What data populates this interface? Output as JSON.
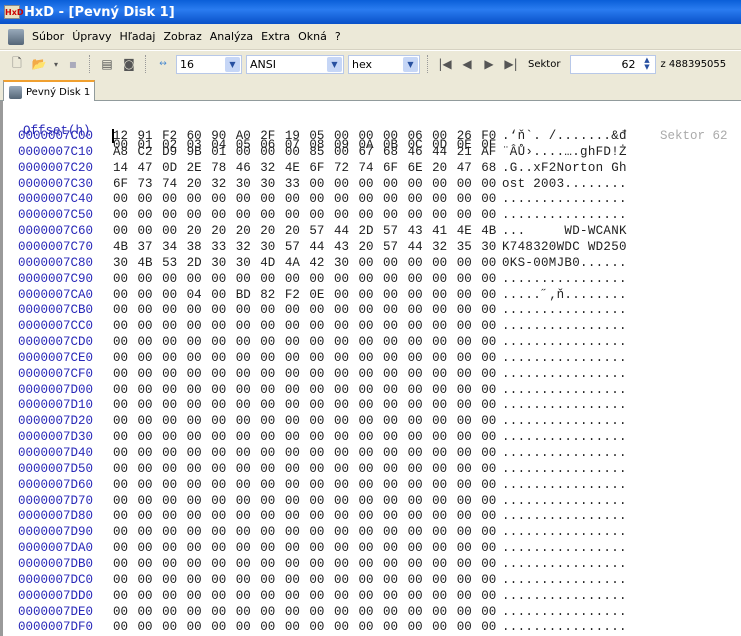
{
  "window": {
    "title": "HxD - [Pevný Disk 1]"
  },
  "menu": [
    "Súbor",
    "Úpravy",
    "Hľadaj",
    "Zobraz",
    "Analýza",
    "Extra",
    "Okná",
    "?"
  ],
  "toolbar": {
    "bytes_per_row": "16",
    "charset": "ANSI",
    "offset_base": "hex",
    "sector_label": "Sektor",
    "sector_value": "62",
    "sector_total": "z 488395055"
  },
  "tab": {
    "label": "Pevný Disk 1"
  },
  "editor": {
    "offset_header": "Offset(h)",
    "columns": [
      "00",
      "01",
      "02",
      "03",
      "04",
      "05",
      "06",
      "07",
      "08",
      "09",
      "0A",
      "0B",
      "0C",
      "0D",
      "0E",
      "0F"
    ],
    "sector_marker": "Sektor 62",
    "rows": [
      {
        "offset": "0000007C00",
        "hex": "12 91 F2 60 90 A0 2F 19 05 00 00 00 06 00 26 F0",
        "ascii": ".‘ň`. /.......&đ"
      },
      {
        "offset": "0000007C10",
        "hex": "A8 C2 D9 9B 01 00 00 00 85 00 67 68 46 44 21 AF",
        "ascii": "¨ÂŮ›....….ghFD!Ż"
      },
      {
        "offset": "0000007C20",
        "hex": "14 47 0D 2E 78 46 32 4E 6F 72 74 6F 6E 20 47 68",
        "ascii": ".G..xF2Norton Gh"
      },
      {
        "offset": "0000007C30",
        "hex": "6F 73 74 20 32 30 30 33 00 00 00 00 00 00 00 00",
        "ascii": "ost 2003........"
      },
      {
        "offset": "0000007C40",
        "hex": "00 00 00 00 00 00 00 00 00 00 00 00 00 00 00 00",
        "ascii": "................"
      },
      {
        "offset": "0000007C50",
        "hex": "00 00 00 00 00 00 00 00 00 00 00 00 00 00 00 00",
        "ascii": "................"
      },
      {
        "offset": "0000007C60",
        "hex": "00 00 00 20 20 20 20 20 57 44 2D 57 43 41 4E 4B",
        "ascii": "...     WD-WCANK"
      },
      {
        "offset": "0000007C70",
        "hex": "4B 37 34 38 33 32 30 57 44 43 20 57 44 32 35 30",
        "ascii": "K748320WDC WD250"
      },
      {
        "offset": "0000007C80",
        "hex": "30 4B 53 2D 30 30 4D 4A 42 30 00 00 00 00 00 00",
        "ascii": "0KS-00MJB0......"
      },
      {
        "offset": "0000007C90",
        "hex": "00 00 00 00 00 00 00 00 00 00 00 00 00 00 00 00",
        "ascii": "................"
      },
      {
        "offset": "0000007CA0",
        "hex": "00 00 00 04 00 BD 82 F2 0E 00 00 00 00 00 00 00",
        "ascii": ".....˝‚ň........"
      },
      {
        "offset": "0000007CB0",
        "hex": "00 00 00 00 00 00 00 00 00 00 00 00 00 00 00 00",
        "ascii": "................"
      },
      {
        "offset": "0000007CC0",
        "hex": "00 00 00 00 00 00 00 00 00 00 00 00 00 00 00 00",
        "ascii": "................"
      },
      {
        "offset": "0000007CD0",
        "hex": "00 00 00 00 00 00 00 00 00 00 00 00 00 00 00 00",
        "ascii": "................"
      },
      {
        "offset": "0000007CE0",
        "hex": "00 00 00 00 00 00 00 00 00 00 00 00 00 00 00 00",
        "ascii": "................"
      },
      {
        "offset": "0000007CF0",
        "hex": "00 00 00 00 00 00 00 00 00 00 00 00 00 00 00 00",
        "ascii": "................"
      },
      {
        "offset": "0000007D00",
        "hex": "00 00 00 00 00 00 00 00 00 00 00 00 00 00 00 00",
        "ascii": "................"
      },
      {
        "offset": "0000007D10",
        "hex": "00 00 00 00 00 00 00 00 00 00 00 00 00 00 00 00",
        "ascii": "................"
      },
      {
        "offset": "0000007D20",
        "hex": "00 00 00 00 00 00 00 00 00 00 00 00 00 00 00 00",
        "ascii": "................"
      },
      {
        "offset": "0000007D30",
        "hex": "00 00 00 00 00 00 00 00 00 00 00 00 00 00 00 00",
        "ascii": "................"
      },
      {
        "offset": "0000007D40",
        "hex": "00 00 00 00 00 00 00 00 00 00 00 00 00 00 00 00",
        "ascii": "................"
      },
      {
        "offset": "0000007D50",
        "hex": "00 00 00 00 00 00 00 00 00 00 00 00 00 00 00 00",
        "ascii": "................"
      },
      {
        "offset": "0000007D60",
        "hex": "00 00 00 00 00 00 00 00 00 00 00 00 00 00 00 00",
        "ascii": "................"
      },
      {
        "offset": "0000007D70",
        "hex": "00 00 00 00 00 00 00 00 00 00 00 00 00 00 00 00",
        "ascii": "................"
      },
      {
        "offset": "0000007D80",
        "hex": "00 00 00 00 00 00 00 00 00 00 00 00 00 00 00 00",
        "ascii": "................"
      },
      {
        "offset": "0000007D90",
        "hex": "00 00 00 00 00 00 00 00 00 00 00 00 00 00 00 00",
        "ascii": "................"
      },
      {
        "offset": "0000007DA0",
        "hex": "00 00 00 00 00 00 00 00 00 00 00 00 00 00 00 00",
        "ascii": "................"
      },
      {
        "offset": "0000007DB0",
        "hex": "00 00 00 00 00 00 00 00 00 00 00 00 00 00 00 00",
        "ascii": "................"
      },
      {
        "offset": "0000007DC0",
        "hex": "00 00 00 00 00 00 00 00 00 00 00 00 00 00 00 00",
        "ascii": "................"
      },
      {
        "offset": "0000007DD0",
        "hex": "00 00 00 00 00 00 00 00 00 00 00 00 00 00 00 00",
        "ascii": "................"
      },
      {
        "offset": "0000007DE0",
        "hex": "00 00 00 00 00 00 00 00 00 00 00 00 00 00 00 00",
        "ascii": "................"
      },
      {
        "offset": "0000007DF0",
        "hex": "00 00 00 00 00 00 00 00 00 00 00 00 00 00 00 00",
        "ascii": "................"
      }
    ]
  }
}
